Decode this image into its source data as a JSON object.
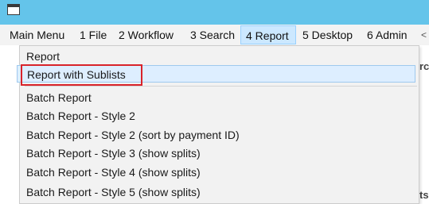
{
  "window": {
    "icon": "app-window-icon",
    "title_bar_color": "#64c4ea"
  },
  "menubar": {
    "items": [
      {
        "label": "Main Menu"
      },
      {
        "label": "1 File"
      },
      {
        "label": "2 Workflow"
      },
      {
        "label": "3 Search"
      },
      {
        "label": "4 Report",
        "active": true
      },
      {
        "label": "5 Desktop"
      },
      {
        "label": "6 Admin"
      }
    ],
    "overflow_label": "<"
  },
  "report_menu": {
    "items": [
      {
        "label": "Report"
      },
      {
        "label": "Report with Sublists",
        "hovered": true,
        "outlined": true
      },
      {
        "label": "Batch Report"
      },
      {
        "label": "Batch Report - Style 2"
      },
      {
        "label": "Batch Report - Style 2 (sort by payment ID)"
      },
      {
        "label": "Batch Report - Style 3 (show splits)"
      },
      {
        "label": "Batch Report - Style 4 (show splits)"
      },
      {
        "label": "Batch Report - Style 5 (show splits)"
      }
    ]
  },
  "background": {
    "fragment_top": "rc",
    "fragment_bottom": "ts"
  },
  "colors": {
    "accent_highlight": "#d9232a",
    "menu_active_bg": "#cce8ff"
  }
}
